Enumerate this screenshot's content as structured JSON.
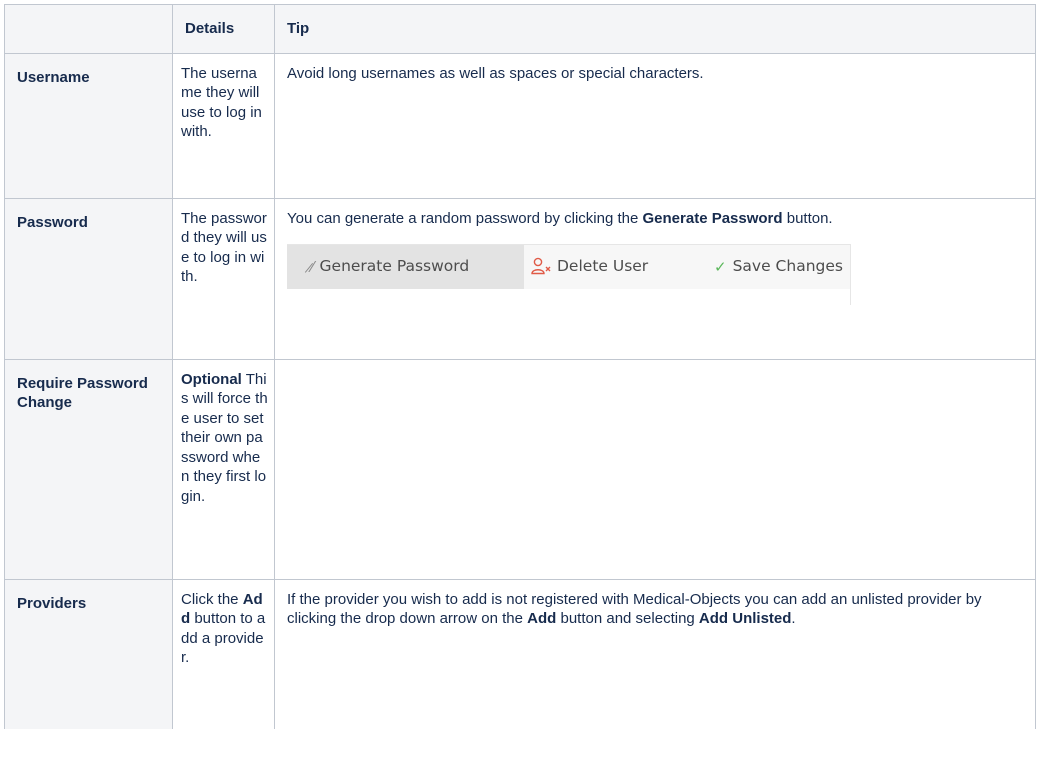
{
  "table": {
    "headers": [
      "",
      "Details",
      "Tip"
    ],
    "rows": [
      {
        "label": "Username",
        "details": "The username they will use to log in with.",
        "tip": "Avoid long usernames as well as spaces or special characters."
      },
      {
        "label": "Password",
        "details": "The password they will use to log in with.",
        "tip_pre": "You can generate a random password by clicking the ",
        "tip_bold": "Generate Password",
        "tip_post": " button."
      },
      {
        "label": "Require Password Change",
        "details_bold": "Optional",
        "details": " This will force the user to set their own password when they first login.",
        "tip": ""
      },
      {
        "label": "Providers",
        "details_pre": "Click the ",
        "details_bold": "Add",
        "details_post": " button to add a provider.",
        "tip_pre": "If the provider you wish to add is not registered with Medical-Objects you can add an unlisted provider by clicking the drop down arrow on the ",
        "tip_bold1": "Add",
        "tip_mid": " button and selecting ",
        "tip_bold2": "Add Unlisted",
        "tip_post": "."
      }
    ]
  },
  "toolbar": {
    "generate_label": "Generate Password",
    "delete_label": "Delete User",
    "save_label": "Save Changes",
    "generate_icon": "magic-wand-icon",
    "delete_icon": "remove-user-icon",
    "save_icon": "checkmark-icon"
  }
}
